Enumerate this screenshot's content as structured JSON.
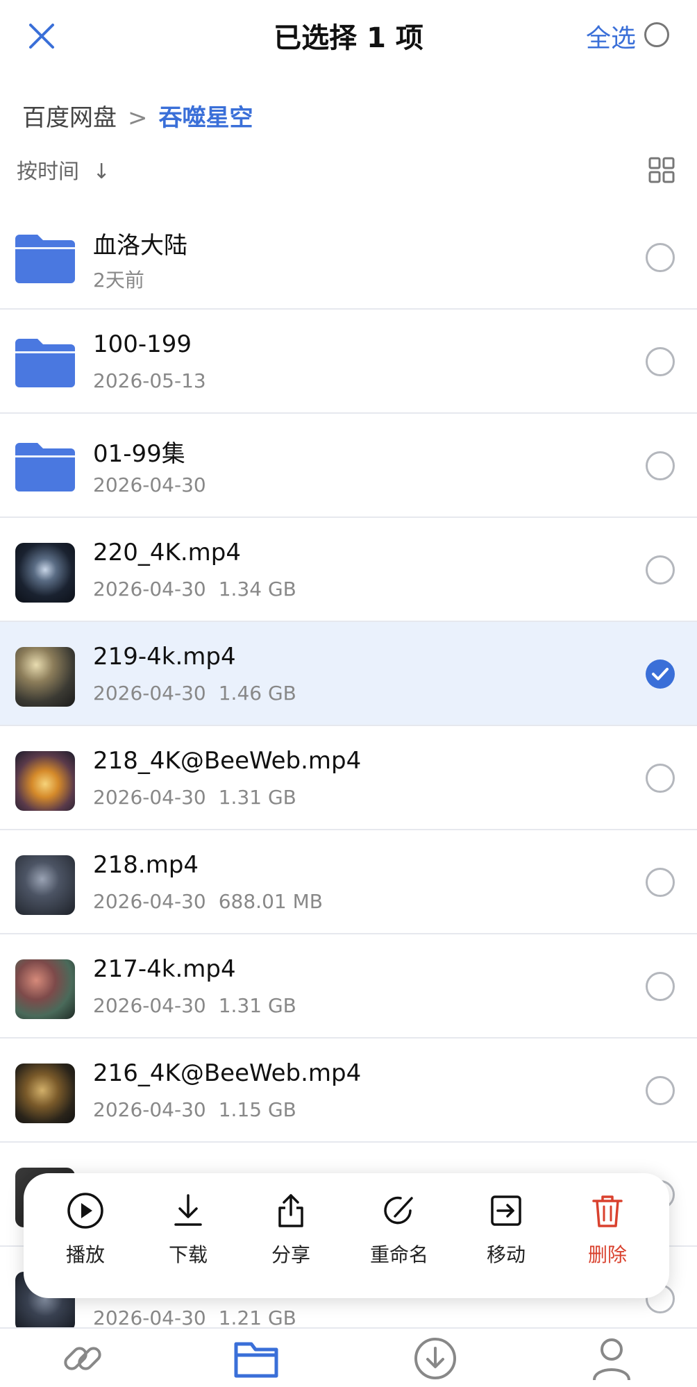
{
  "header": {
    "title": "已选择 1 项",
    "select_all_label": "全选"
  },
  "breadcrumb": {
    "root": "百度网盘",
    "separator": ">",
    "current": "吞噬星空"
  },
  "sort": {
    "label": "按时间",
    "arrow": "↓"
  },
  "files": [
    {
      "name": "血洛大陆",
      "date": "2天前",
      "size": "",
      "type": "folder",
      "selected": false
    },
    {
      "name": "100-199",
      "date": "2026-05-13",
      "size": "",
      "type": "folder",
      "selected": false
    },
    {
      "name": "01-99集",
      "date": "2026-04-30",
      "size": "",
      "type": "folder",
      "selected": false
    },
    {
      "name": "220_4K.mp4",
      "date": "2026-04-30",
      "size": "1.34 GB",
      "type": "video",
      "selected": false
    },
    {
      "name": "219-4k.mp4",
      "date": "2026-04-30",
      "size": "1.46 GB",
      "type": "video",
      "selected": true
    },
    {
      "name": "218_4K@BeeWeb.mp4",
      "date": "2026-04-30",
      "size": "1.31 GB",
      "type": "video",
      "selected": false
    },
    {
      "name": "218.mp4",
      "date": "2026-04-30",
      "size": "688.01 MB",
      "type": "video",
      "selected": false
    },
    {
      "name": "217-4k.mp4",
      "date": "2026-04-30",
      "size": "1.31 GB",
      "type": "video",
      "selected": false
    },
    {
      "name": "216_4K@BeeWeb.mp4",
      "date": "2026-04-30",
      "size": "1.15 GB",
      "type": "video",
      "selected": false
    },
    {
      "name": "",
      "date": "",
      "size": "",
      "type": "video",
      "selected": false
    },
    {
      "name": "",
      "date": "2026-04-30",
      "size": "1.21 GB",
      "type": "video",
      "selected": false
    }
  ],
  "actions": [
    {
      "label": "播放",
      "icon": "play-icon"
    },
    {
      "label": "下载",
      "icon": "download-icon"
    },
    {
      "label": "分享",
      "icon": "share-icon"
    },
    {
      "label": "重命名",
      "icon": "rename-icon"
    },
    {
      "label": "移动",
      "icon": "move-icon"
    },
    {
      "label": "删除",
      "icon": "trash-icon"
    }
  ],
  "tabs": [
    {
      "icon": "link-icon"
    },
    {
      "icon": "folder-icon",
      "active": true
    },
    {
      "icon": "download-circle-icon"
    },
    {
      "icon": "person-icon"
    }
  ],
  "colors": {
    "accent": "#3a6fd8",
    "selected_row": "#eaf1fc",
    "danger": "#d9412e",
    "folder": "#4a78e0"
  }
}
